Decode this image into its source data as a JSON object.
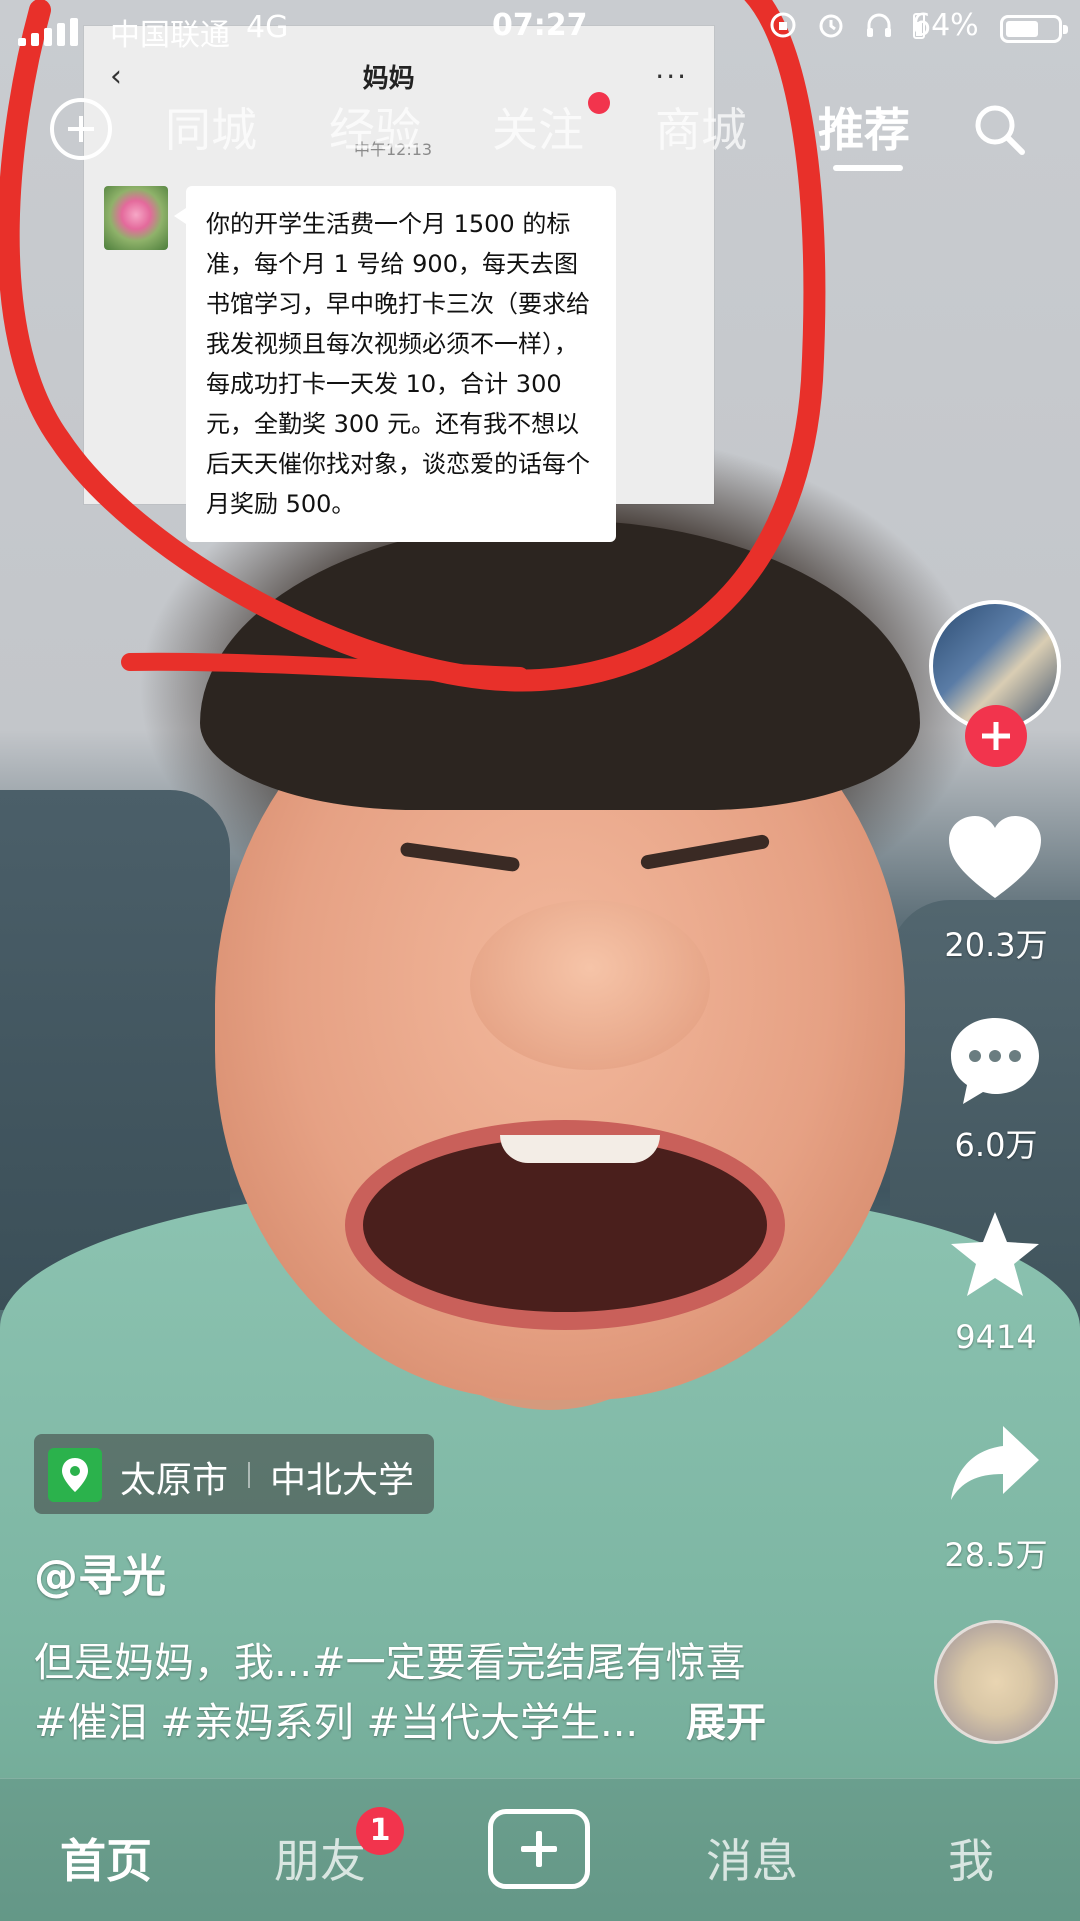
{
  "status_bar": {
    "carrier": "中国联通",
    "network": "4G",
    "time": "07:27",
    "battery_text": "64%",
    "battery_level": 0.64
  },
  "top_nav": {
    "tabs": [
      {
        "label": "同城"
      },
      {
        "label": "经验"
      },
      {
        "label": "关注"
      },
      {
        "label": "商城"
      },
      {
        "label": "推荐"
      }
    ],
    "active_tab": "推荐",
    "notification_dot_on": "关注"
  },
  "chat_image": {
    "title": "妈妈",
    "back_glyph": "‹",
    "more_glyph": "···",
    "time": "中午12:13",
    "message": "你的开学生活费一个月 1500 的标准，每个月 1 号给 900，每天去图书馆学习，早中晚打卡三次（要求给我发视频且每次视频必须不一样），每成功打卡一天发 10，合计 300 元，全勤奖 300 元。还有我不想以后天天催你找对象，谈恋爱的话每个月奖励 500。"
  },
  "right_rail": {
    "like_count": "20.3万",
    "comment_count": "6.0万",
    "favorite_count": "9414",
    "share_count": "28.5万"
  },
  "location": {
    "city": "太原市",
    "place": "中北大学"
  },
  "video": {
    "author": "@寻光",
    "description_line1": "但是妈妈，我...#一定要看完结尾有惊喜",
    "description_line2": "#催泪 #亲妈系列 #当代大学生...",
    "expand_label": "展开"
  },
  "bottom_nav": {
    "items": [
      {
        "label": "首页"
      },
      {
        "label": "朋友"
      },
      {
        "label": "消息"
      },
      {
        "label": "我"
      }
    ],
    "friends_badge": "1",
    "active_item": "首页"
  },
  "colors": {
    "accent_red": "#f2344d",
    "annotation_red": "#e8302a",
    "location_green": "#2bb24c"
  },
  "icons": [
    "add-circle-icon",
    "search-icon",
    "heart-icon",
    "comment-icon",
    "star-icon",
    "share-icon",
    "location-pin-icon",
    "create-plus-icon",
    "music-disc-icon"
  ]
}
